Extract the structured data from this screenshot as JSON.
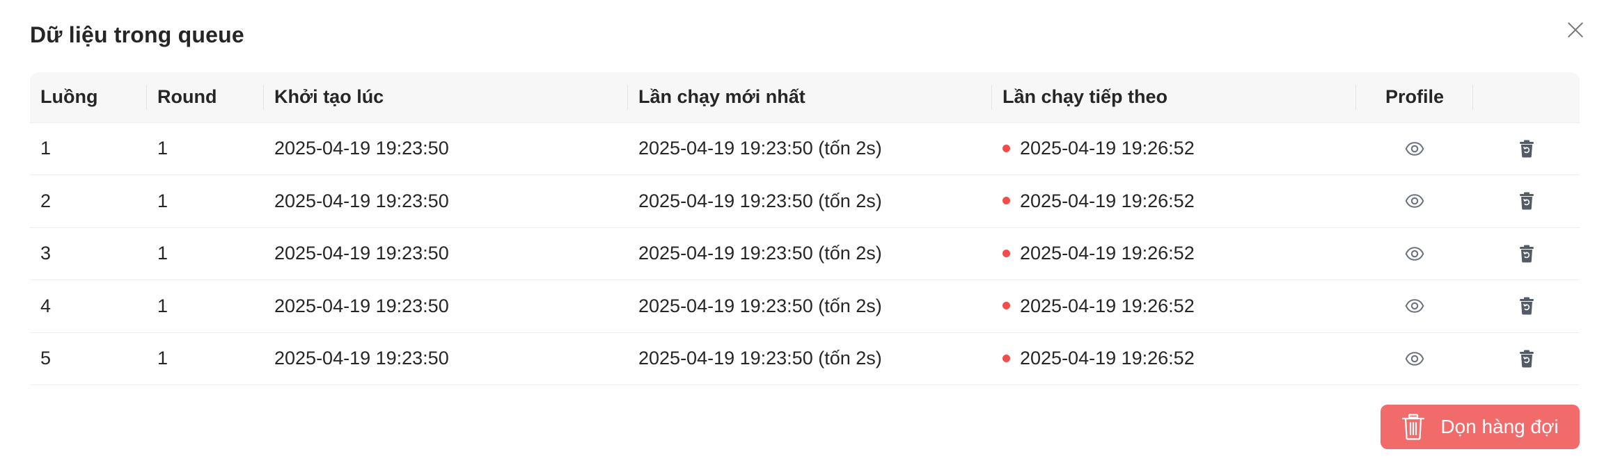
{
  "modal": {
    "title": "Dữ liệu trong queue",
    "close_icon": "close-icon"
  },
  "table": {
    "headers": [
      "Luồng",
      "Round",
      "Khởi tạo lúc",
      "Lần chạy mới nhất",
      "Lần chạy tiếp theo",
      "Profile",
      ""
    ],
    "rows": [
      {
        "thread": "1",
        "round": "1",
        "created_at": "2025-04-19 19:23:50",
        "last_run": "2025-04-19 19:23:50 (tốn 2s)",
        "next_run": "2025-04-19 19:26:52"
      },
      {
        "thread": "2",
        "round": "1",
        "created_at": "2025-04-19 19:23:50",
        "last_run": "2025-04-19 19:23:50 (tốn 2s)",
        "next_run": "2025-04-19 19:26:52"
      },
      {
        "thread": "3",
        "round": "1",
        "created_at": "2025-04-19 19:23:50",
        "last_run": "2025-04-19 19:23:50 (tốn 2s)",
        "next_run": "2025-04-19 19:26:52"
      },
      {
        "thread": "4",
        "round": "1",
        "created_at": "2025-04-19 19:23:50",
        "last_run": "2025-04-19 19:23:50 (tốn 2s)",
        "next_run": "2025-04-19 19:26:52"
      },
      {
        "thread": "5",
        "round": "1",
        "created_at": "2025-04-19 19:23:50",
        "last_run": "2025-04-19 19:23:50 (tốn 2s)",
        "next_run": "2025-04-19 19:26:52"
      }
    ],
    "status_dot_color": "#f24c4c",
    "profile_icon": "eye-icon",
    "action_icon": "trash-restore-icon"
  },
  "footer": {
    "clear_button_label": "Dọn hàng đợi",
    "clear_button_icon": "trash-icon",
    "clear_button_color": "#f26b6b"
  }
}
